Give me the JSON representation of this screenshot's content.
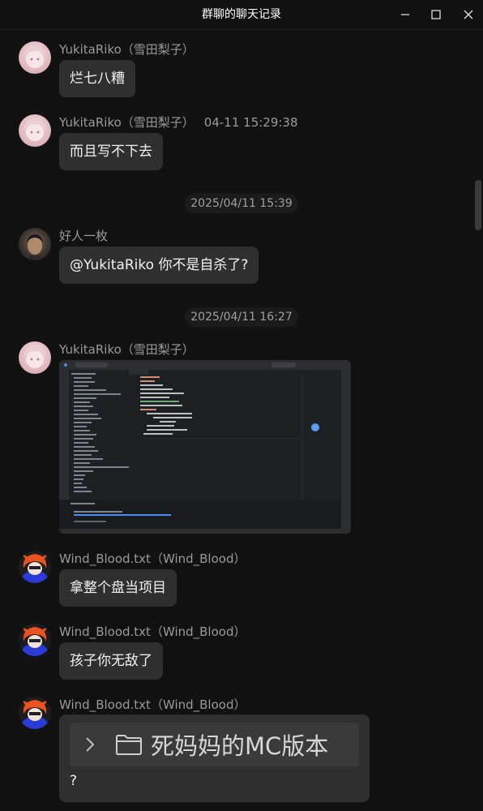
{
  "window": {
    "title": "群聊的聊天记录"
  },
  "messages": [
    {
      "sender": "YukitaRiko（雪田梨子）",
      "text": "烂七八糟"
    },
    {
      "sender": "YukitaRiko（雪田梨子）",
      "time": "04-11 15:29:38",
      "text": "而且写不下去"
    },
    {
      "divider": "2025/04/11 15:39"
    },
    {
      "sender": "好人一枚",
      "text": "@YukitaRiko 你不是自杀了?"
    },
    {
      "divider": "2025/04/11 16:27"
    },
    {
      "sender": "YukitaRiko（雪田梨子）",
      "image": "ide-screenshot"
    },
    {
      "sender": "Wind_Blood.txt（Wind_Blood）",
      "text": "拿整个盘当项目"
    },
    {
      "sender": "Wind_Blood.txt（Wind_Blood）",
      "text": "孩子你无敌了"
    },
    {
      "sender": "Wind_Blood.txt（Wind_Blood）",
      "folder": "死妈妈的MC版本",
      "text": "?"
    }
  ],
  "icons": {
    "minimize": "minimize-icon",
    "maximize": "maximize-icon",
    "close": "close-icon",
    "chevron": "chevron-right-icon",
    "folder": "folder-icon"
  }
}
